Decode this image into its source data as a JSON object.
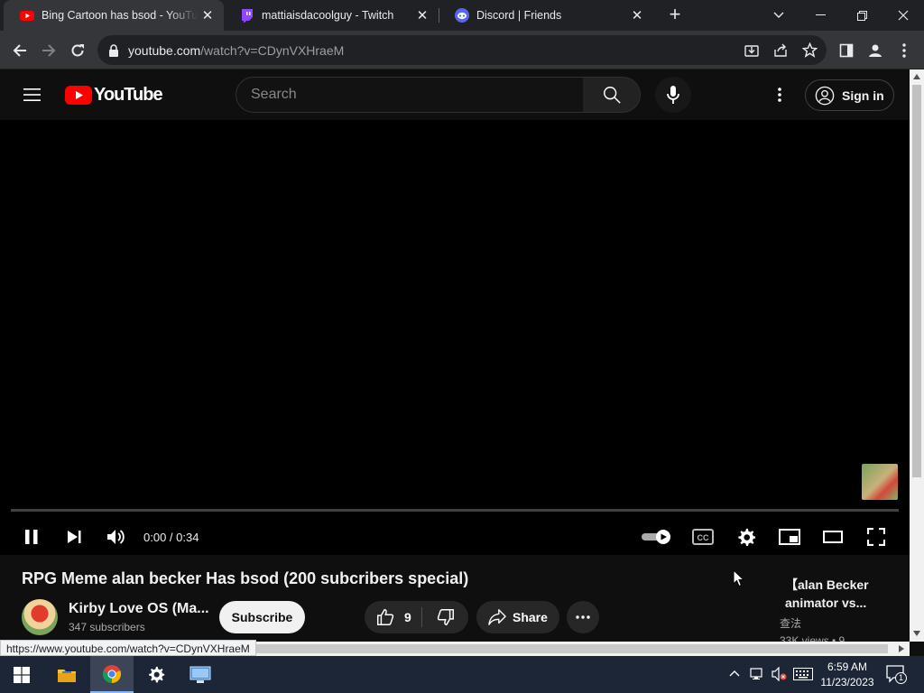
{
  "browser": {
    "tabs": [
      {
        "title": "Bing Cartoon has bsod - YouTube",
        "favicon": "youtube-icon",
        "active": true
      },
      {
        "title": "mattiaisdacoolguy - Twitch",
        "favicon": "twitch-icon",
        "active": false
      },
      {
        "title": "Discord | Friends",
        "favicon": "discord-icon",
        "active": false
      }
    ],
    "url_host": "youtube.com",
    "url_path": "/watch?v=CDynVXHraeM",
    "status_url": "https://www.youtube.com/watch?v=CDynVXHraeM"
  },
  "youtube": {
    "logo_text": "YouTube",
    "search_placeholder": "Search",
    "signin_label": "Sign in"
  },
  "player": {
    "time": "0:00 / 0:34",
    "progress": 0
  },
  "video": {
    "title": "RPG Meme alan becker Has bsod (200 subcribers special)",
    "channel": "Kirby Love OS (Ma...",
    "subscribers": "347 subscribers",
    "subscribe_label": "Subscribe",
    "likes": "9",
    "share_label": "Share"
  },
  "related": {
    "title": "【alan Becker animator vs...",
    "channel": "查法",
    "views": "33K views • 9"
  },
  "taskbar": {
    "time": "6:59 AM",
    "date": "11/23/2023",
    "notification_count": "1"
  },
  "colors": {
    "youtube_red": "#ff0000",
    "twitch_purple": "#9146ff",
    "discord_blurple": "#5865f2",
    "taskbar": "#1c2637"
  }
}
